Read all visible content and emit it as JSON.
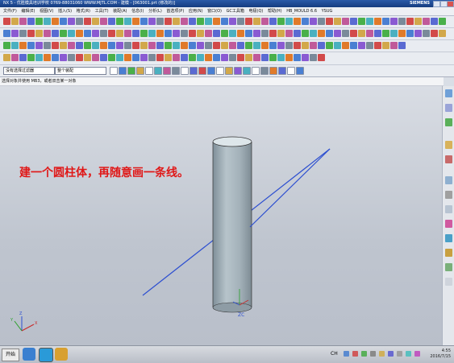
{
  "titlebar": {
    "title": "NX 5 - 优胜模具培训学校  0769-88031060  WWW.MJTL.COM - 建模 - [063001.prt (修改的)]",
    "brand": "SIEMENS"
  },
  "menu": {
    "items": [
      "文件(F)",
      "编辑(E)",
      "视图(V)",
      "插入(S)",
      "格式(R)",
      "工具(T)",
      "装配(A)",
      "信息(I)",
      "分析(L)",
      "首选项(P)",
      "应用(N)",
      "窗口(O)",
      "GC工具箱",
      "电极(Q)",
      "帮助(H)",
      "HB_MOULD 6.6",
      "YSUG"
    ]
  },
  "selection": {
    "filter": "没有选择过滤器",
    "scope": "整个装配"
  },
  "prompt": "选择对象并使用 MB3，或者双击某一对象",
  "annotation": "建一个圆柱体，再随意画一条线。",
  "triad": {
    "x": "X",
    "y": "Y",
    "z": "Z"
  },
  "csys_label": "ZC",
  "taskbar": {
    "start": "开始",
    "lang": "CH",
    "time": "4:55",
    "date": "2016/7/15"
  },
  "colors": {
    "annotation": "#e01818",
    "line": "#2d4fd0",
    "cylinder": "#9eadb6",
    "title": "#1f4f99"
  }
}
